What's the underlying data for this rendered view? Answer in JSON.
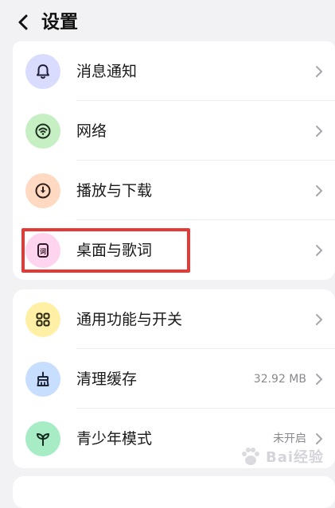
{
  "header": {
    "title": "设置"
  },
  "groups": [
    {
      "items": [
        {
          "label": "消息通知",
          "icon": "bell-icon",
          "icon_bg": "#d9dcff",
          "icon_color": "#1f1f3a"
        },
        {
          "label": "网络",
          "icon": "wifi-icon",
          "icon_bg": "#c6f0c3",
          "icon_color": "#1f2f1f"
        },
        {
          "label": "播放与下载",
          "icon": "download-circle-icon",
          "icon_bg": "#ffd9c2",
          "icon_color": "#2f1f1a"
        },
        {
          "label": "桌面与歌词",
          "icon": "lyrics-icon",
          "icon_bg": "#ffd4ee",
          "icon_color": "#2f1a28"
        }
      ]
    },
    {
      "items": [
        {
          "label": "通用功能与开关",
          "icon": "grid-icon",
          "icon_bg": "#fff0a6",
          "icon_color": "#2a2610"
        },
        {
          "label": "清理缓存",
          "value": "32.92 MB",
          "icon": "broom-icon",
          "icon_bg": "#c7deff",
          "icon_color": "#1a2233"
        },
        {
          "label": "青少年模式",
          "value": "未开启",
          "icon": "sprout-icon",
          "icon_bg": "#a8ecc6",
          "icon_color": "#13291d"
        }
      ]
    }
  ],
  "highlight_color": "#e53935",
  "watermark": {
    "text": "Bai经验"
  }
}
